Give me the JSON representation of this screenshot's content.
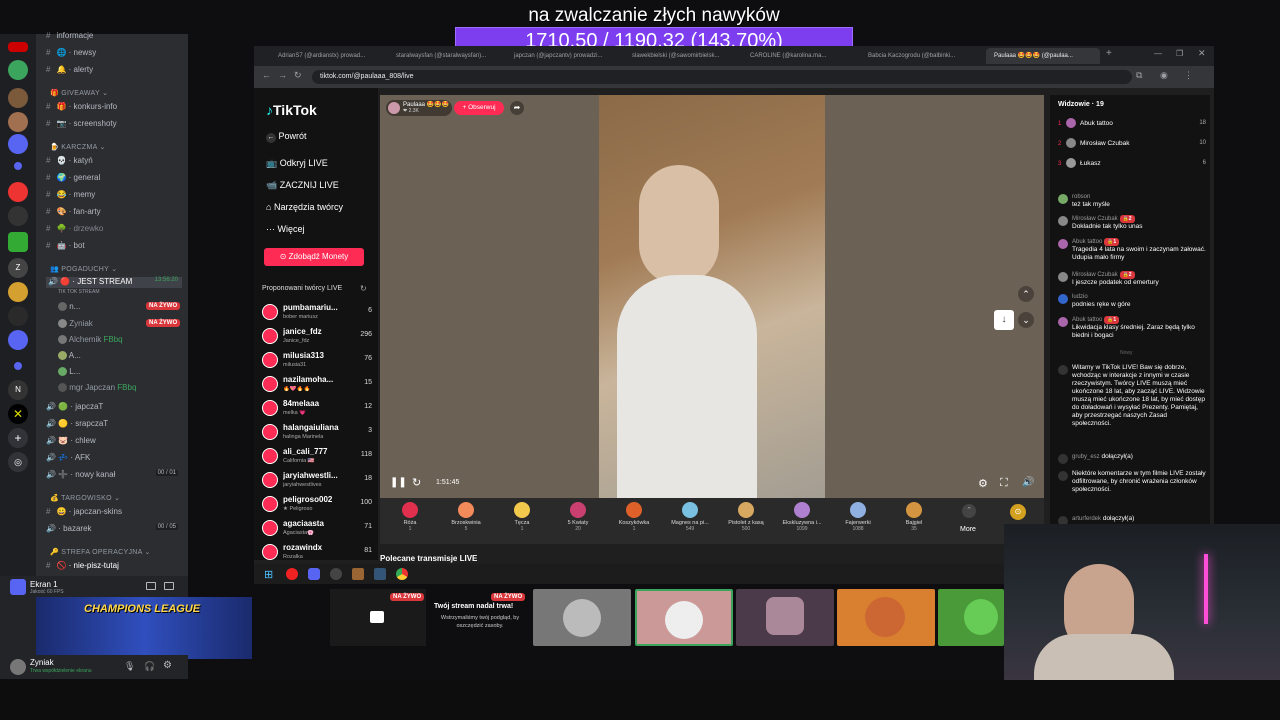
{
  "overlay": {
    "title": "na zwalczanie złych nawyków",
    "goal": "1710.50 / 1190.32 (143.70%)"
  },
  "discord": {
    "channels": [
      {
        "name": "informacje",
        "icon": "info-icon"
      },
      {
        "name": "newsy",
        "icon": "globe-icon"
      },
      {
        "name": "alerty",
        "icon": "bell-icon"
      }
    ],
    "cat_giveaway": "GIVEAWAY",
    "giveaway_channels": [
      "konkurs-info",
      "screenshoty"
    ],
    "cat_karczma": "KARCZMA",
    "karczma_channels": [
      "katyń",
      "general",
      "memy",
      "fan-arty",
      "drzewko",
      "bot"
    ],
    "cat_pogaduchy": "POGADUCHY",
    "stream_channel": "JEST STREAM",
    "stream_time": "13:56:20",
    "stream_sub": "TIK TOK STREAM",
    "live_badge": "NA ŻYWO",
    "voice_users": [
      {
        "name": "n...",
        "live": true
      },
      {
        "name": "Zyniak",
        "live": true
      },
      {
        "name": "Alchemik",
        "tag": "FBbq"
      },
      {
        "name": "A..."
      },
      {
        "name": "L..."
      },
      {
        "name": "mgr Japczan",
        "tag": "FBbq"
      }
    ],
    "voice_channels": [
      {
        "name": "japczaT"
      },
      {
        "name": "srapczaT"
      },
      {
        "name": "chlew"
      },
      {
        "name": "AFK"
      },
      {
        "name": "nowy kanał",
        "count": "00 / 01"
      }
    ],
    "cat_targowisko": "TARGOWISKO",
    "targ_channels": [
      {
        "name": "japczan-skins"
      },
      {
        "name": "bazarek",
        "count": "00 / 05"
      }
    ],
    "cat_strefa": "STREFA OPERACYJNA",
    "strefa_channels": [
      "nie-pisz-tutaj"
    ],
    "screen_share": {
      "title": "Ekran 1",
      "sub": "Jakość 60 FPS",
      "thumb_text": "CHAMPIONS LEAGUE"
    },
    "user": {
      "name": "Zyniak",
      "status": "Trwa współdzielenie ekranu"
    }
  },
  "browser": {
    "tabs": [
      "AdrianS7 (@ardianstx) prowad...",
      "staralwaysfan (@staralwaysfan)...",
      "japczan (@japczantv) prowadzi...",
      "slawekbielski (@sawomirbielsk...",
      "CAROLINE (@karolina.ma...",
      "Babcia Kaczogrodu (@balbinki...",
      "Paulaaa 🤩🤩🤩 (@paulaa..."
    ],
    "url": "tiktok.com/@paulaaa_808/live"
  },
  "tiktok": {
    "logo": "TikTok",
    "nav": [
      {
        "label": "Powrót",
        "icon": "arrow-left-icon"
      },
      {
        "label": "Odkryj LIVE",
        "icon": "live-tv-icon"
      },
      {
        "label": "ZACZNIJ LIVE",
        "icon": "camera-icon"
      },
      {
        "label": "Narzędzia twórcy",
        "icon": "home-icon"
      },
      {
        "label": "Więcej",
        "icon": "more-icon"
      }
    ],
    "coins_button": "Zdobądź Monety",
    "suggested_header": "Proponowani twórcy LIVE",
    "creators": [
      {
        "name": "pumbamariu...",
        "sub": "bober mariusz",
        "count": "6"
      },
      {
        "name": "janice_fdz",
        "sub": "Janice_fdz",
        "count": "296"
      },
      {
        "name": "milusia313",
        "sub": "milusia31",
        "count": "76"
      },
      {
        "name": "nazilamoha...",
        "sub": "🔥💖🔥🔥",
        "count": "15"
      },
      {
        "name": "84melaaa",
        "sub": "melka 💗",
        "count": "12"
      },
      {
        "name": "halangaiuliana",
        "sub": "halinga Marinela",
        "count": "3"
      },
      {
        "name": "ali_cali_777",
        "sub": "California 🇺🇸",
        "count": "118"
      },
      {
        "name": "jaryiahwestli...",
        "sub": "jaryiahwestlives",
        "count": "18"
      },
      {
        "name": "peligroso002",
        "sub": "★ Peligroso",
        "count": "100"
      },
      {
        "name": "agaciaasta",
        "sub": "Agaciasta🌸",
        "count": "71"
      },
      {
        "name": "rozawindx",
        "sub": "Rozalka",
        "count": "81"
      }
    ],
    "host": {
      "name": "Paulaaa 🤩🤩🤩",
      "likes": "❤ 2.3K",
      "follow": "+ Obserwuj"
    },
    "timer": "1:51:45",
    "gifts": [
      {
        "label": "Róża",
        "price": "1",
        "color": "#e0304e"
      },
      {
        "label": "Brzoskwinia",
        "price": "5",
        "color": "#f28a5a"
      },
      {
        "label": "Tęcza",
        "price": "1",
        "color": "#f2c94c"
      },
      {
        "label": "5 Kwiaty",
        "price": "20",
        "color": "#c94070"
      },
      {
        "label": "Koszykówka",
        "price": "1",
        "color": "#e0602a"
      },
      {
        "label": "Magnes na pi...",
        "price": "549",
        "color": "#7ac0e0"
      },
      {
        "label": "Pistolet z kasą",
        "price": "500",
        "color": "#d6a860"
      },
      {
        "label": "Ekskluzywna i...",
        "price": "1099",
        "color": "#b080d0"
      },
      {
        "label": "Fajerwerki",
        "price": "1088",
        "color": "#8fb0e0"
      },
      {
        "label": "Bajgiel",
        "price": "35",
        "color": "#d49540"
      }
    ],
    "more_label": "More",
    "recommended": "Polecane transmisje LIVE",
    "viewers_header": "Widzowie · 19",
    "top_viewers": [
      {
        "rank": "1",
        "name": "Abuk tattoo",
        "score": "18"
      },
      {
        "rank": "2",
        "name": "Mirosław Czubak",
        "score": "10"
      },
      {
        "rank": "3",
        "name": "Łukasz",
        "score": "6"
      }
    ],
    "chat": [
      {
        "user": "robson",
        "text": "też tak myśle"
      },
      {
        "user": "Mirosław Czubak",
        "text": "Dokładnie tak tylko unas"
      },
      {
        "user": "Abuk tattoo",
        "text": "Tragedia 4 lata na swoim i zaczynam żałować. Udupia mało firmy"
      },
      {
        "user": "Mirosław Czubak",
        "text": "I jeszcze podatek od emertury"
      },
      {
        "user": "ludzio",
        "text": "podnies ręke w góre"
      },
      {
        "user": "Abuk tattoo",
        "text": "Likwidacja klasy średniej. Zaraz będą tylko biedni i bogaci"
      }
    ],
    "new_label": "Nowy",
    "system_msg": "Witamy w TikTok LIVE! Baw się dobrze, wchodząc w interakcje z innymi w czasie rzeczywistym. Twórcy LIVE muszą mieć ukończone 18 lat, aby zacząć LIVE. Widzowie muszą mieć ukończone 18 lat, by mieć dostęp do doładowań i wysyłać Prezenty. Pamiętaj, aby przestrzegać naszych Zasad społeczności.",
    "join1": {
      "user": "gruby_esz",
      "text": "dołączył(a)"
    },
    "filter_msg": "Niektóre komentarze w tym filmie LIVE zostały odfiltrowane, by chronić wrażenia członków społeczności.",
    "join2": {
      "user": "arturferdek",
      "text": "dołączył(a)"
    }
  },
  "stream_panel": {
    "live_badge": "NA ŻYWO",
    "title": "Twój stream nadal trwa!",
    "sub": "Wstrzymaliśmy twój podgląd, by oszczędzić zasoby."
  }
}
